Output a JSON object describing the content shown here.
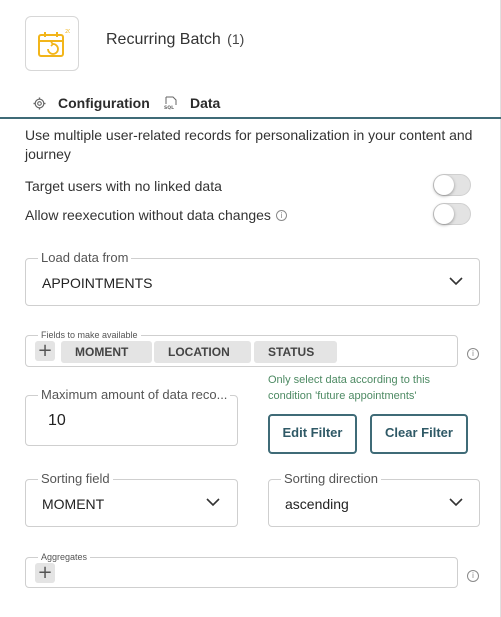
{
  "header": {
    "title": "Recurring Batch",
    "count": "(1)",
    "icon": "calendar-recurring-icon",
    "accent": "#f2b51a"
  },
  "tabs": [
    {
      "label": "Configuration",
      "icon": "gear-icon"
    },
    {
      "label": "Data",
      "icon": "sql-file-icon"
    }
  ],
  "colors": {
    "tab_underline": "#3f6b77",
    "hint": "#4d8a63",
    "button_border": "#3f6b77"
  },
  "description": "Use multiple user-related records for personalization in your content and journey",
  "toggles": [
    {
      "label": "Target users with no linked data",
      "on": false
    },
    {
      "label": "Allow reexecution without data changes",
      "on": false,
      "info": "i"
    }
  ],
  "load_data": {
    "label": "Load data from",
    "value": "APPOINTMENTS"
  },
  "fields": {
    "label": "Fields to make available",
    "chips": [
      "MOMENT",
      "LOCATION",
      "STATUS"
    ],
    "add": "+",
    "info": "i"
  },
  "max_records": {
    "label": "Maximum amount of data reco...",
    "value": "10"
  },
  "filter": {
    "hint": "Only select data according to this condition 'future appointments'",
    "edit_label": "Edit Filter",
    "clear_label": "Clear Filter"
  },
  "sorting_field": {
    "label": "Sorting field",
    "value": "MOMENT"
  },
  "sorting_direction": {
    "label": "Sorting direction",
    "value": "ascending"
  },
  "aggregates": {
    "label": "Aggregates",
    "add": "+",
    "info": "i"
  }
}
